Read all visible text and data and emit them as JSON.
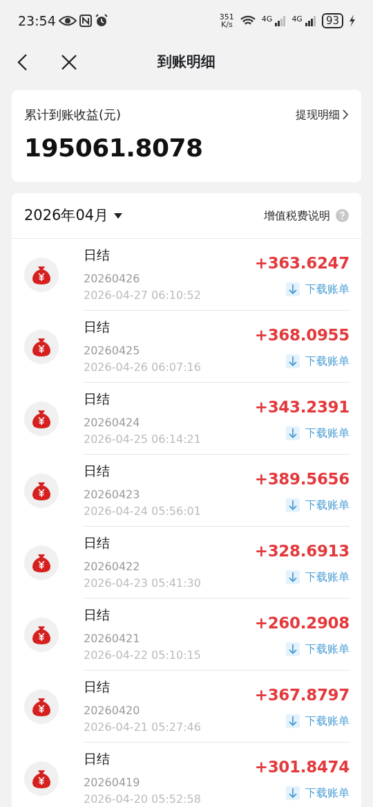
{
  "status_bar": {
    "time": "23:54",
    "speed": "351",
    "speed_unit": "K/s",
    "network_1": "4G",
    "network_2": "4G",
    "battery": "93"
  },
  "header": {
    "title": "到账明细"
  },
  "summary": {
    "label": "累计到账收益(元)",
    "link": "提现明细",
    "total": "195061.8078"
  },
  "filter": {
    "month": "2026年04月",
    "tax_note": "增值税费说明"
  },
  "records": [
    {
      "title": "日结",
      "date": "20260426",
      "time": "2026-04-27 06:10:52",
      "amount": "+363.6247",
      "download": "下载账单"
    },
    {
      "title": "日结",
      "date": "20260425",
      "time": "2026-04-26 06:07:16",
      "amount": "+368.0955",
      "download": "下载账单"
    },
    {
      "title": "日结",
      "date": "20260424",
      "time": "2026-04-25 06:14:21",
      "amount": "+343.2391",
      "download": "下载账单"
    },
    {
      "title": "日结",
      "date": "20260423",
      "time": "2026-04-24 05:56:01",
      "amount": "+389.5656",
      "download": "下载账单"
    },
    {
      "title": "日结",
      "date": "20260422",
      "time": "2026-04-23 05:41:30",
      "amount": "+328.6913",
      "download": "下载账单"
    },
    {
      "title": "日结",
      "date": "20260421",
      "time": "2026-04-22 05:10:15",
      "amount": "+260.2908",
      "download": "下载账单"
    },
    {
      "title": "日结",
      "date": "20260420",
      "time": "2026-04-21 05:27:46",
      "amount": "+367.8797",
      "download": "下载账单"
    },
    {
      "title": "日结",
      "date": "20260419",
      "time": "2026-04-20 05:52:58",
      "amount": "+301.8474",
      "download": "下载账单"
    }
  ]
}
